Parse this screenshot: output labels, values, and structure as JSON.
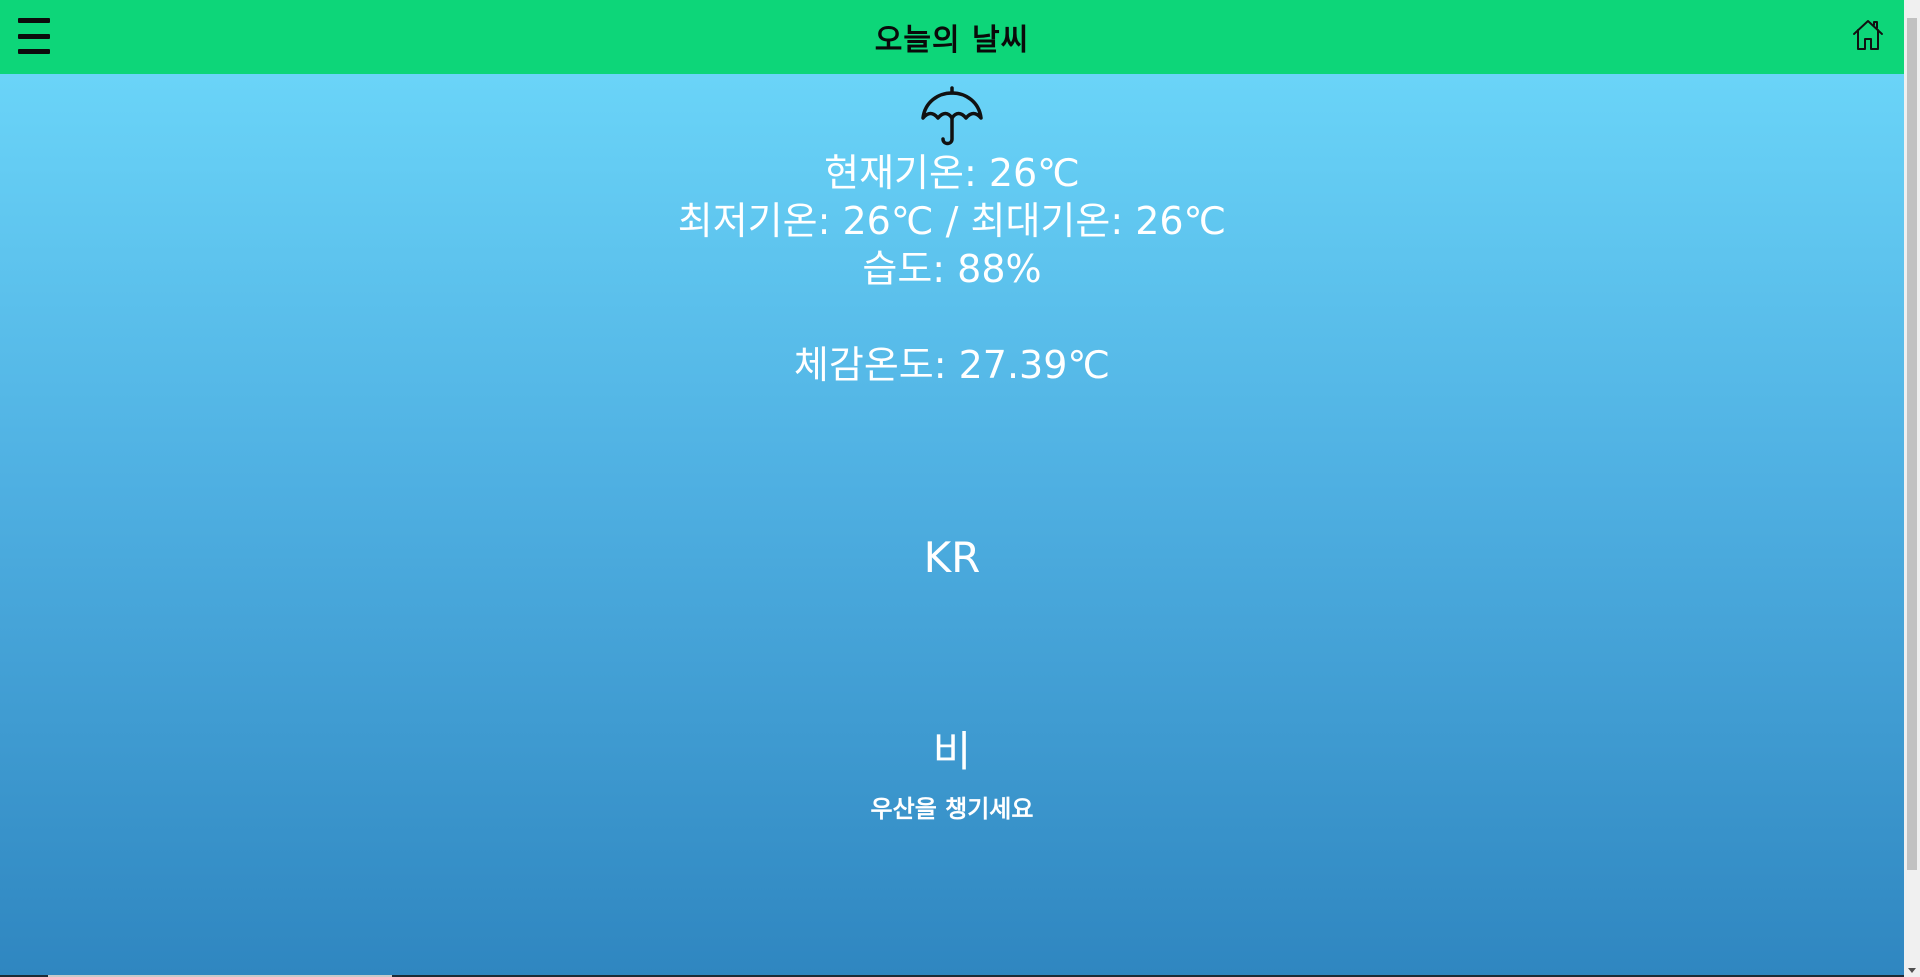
{
  "header": {
    "title": "오늘의 날씨",
    "menu_icon": "hamburger-menu-icon",
    "home_icon": "home-icon",
    "background_color": "#0dd679"
  },
  "weather": {
    "icon": "umbrella-icon",
    "current_temp": "현재기온: 26℃",
    "min_max": "최저기온: 26℃ / 최대기온: 26℃",
    "humidity": "습도: 88%",
    "feels_like": "체감온도: 27.39℃",
    "country": "KR",
    "condition": "비",
    "advice": "우산을 챙기세요"
  },
  "theme": {
    "gradient_top": "#6ad4f8",
    "gradient_bottom": "#2f86c0",
    "text_color": "#ffffff"
  }
}
